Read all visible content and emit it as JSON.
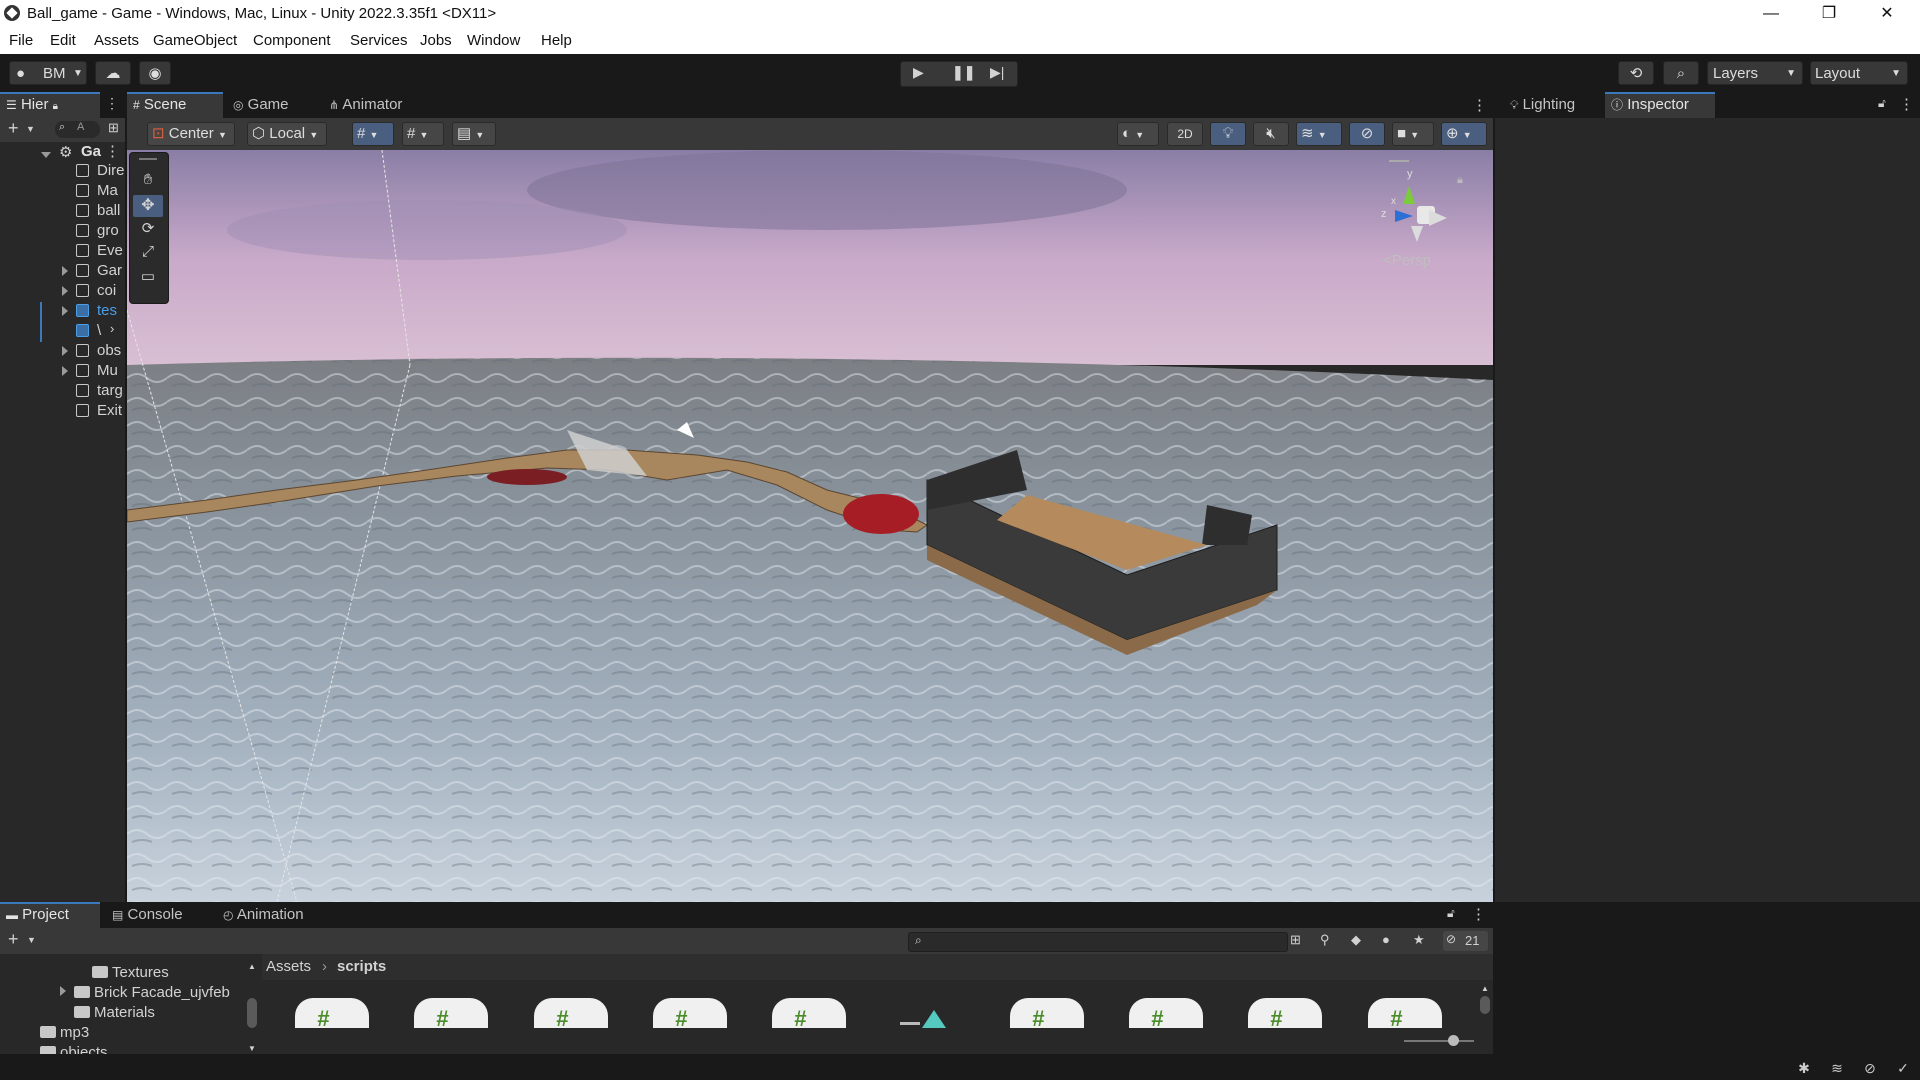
{
  "window": {
    "title": "Ball_game - Game - Windows, Mac, Linux - Unity 2022.3.35f1 <DX11>",
    "minimize": "—",
    "maximize": "❐",
    "close": "✕"
  },
  "menu": [
    "File",
    "Edit",
    "Assets",
    "GameObject",
    "Component",
    "Services",
    "Jobs",
    "Window",
    "Help"
  ],
  "toolbar": {
    "account_label": "BM",
    "layers_label": "Layers",
    "layout_label": "Layout"
  },
  "hierarchy": {
    "tab_label": "Hier",
    "search_placeholder": "A",
    "scene_name": "Ga",
    "items": [
      "Dire",
      "Ma",
      "ball",
      "gro",
      "Eve",
      "Gar",
      "coi",
      "tes",
      "\\",
      "obs",
      "Mu",
      "targ",
      "Exit"
    ]
  },
  "scene_tabs": [
    "Scene",
    "Game",
    "Animator"
  ],
  "scene_toolbar": {
    "pivot": "Center",
    "space": "Local",
    "mode_2d": "2D"
  },
  "gizmo": {
    "y_label": "y",
    "z_label": "z",
    "x_label": "x",
    "projection": "<Persp"
  },
  "right_tabs": [
    "Lighting",
    "Inspector"
  ],
  "bottom_tabs": [
    "Project",
    "Console",
    "Animation"
  ],
  "project": {
    "tree": [
      "Textures",
      "Brick Facade_ujvfeb",
      "Materials",
      "mp3",
      "objects"
    ],
    "breadcrumb": [
      "Assets",
      "scripts"
    ],
    "hidden_count": "21",
    "file_glyph": "#"
  },
  "colors": {
    "accent": "#3a79bb",
    "panel": "#282828",
    "toolbar": "#383838",
    "selected_text": "#4c9ee8"
  }
}
